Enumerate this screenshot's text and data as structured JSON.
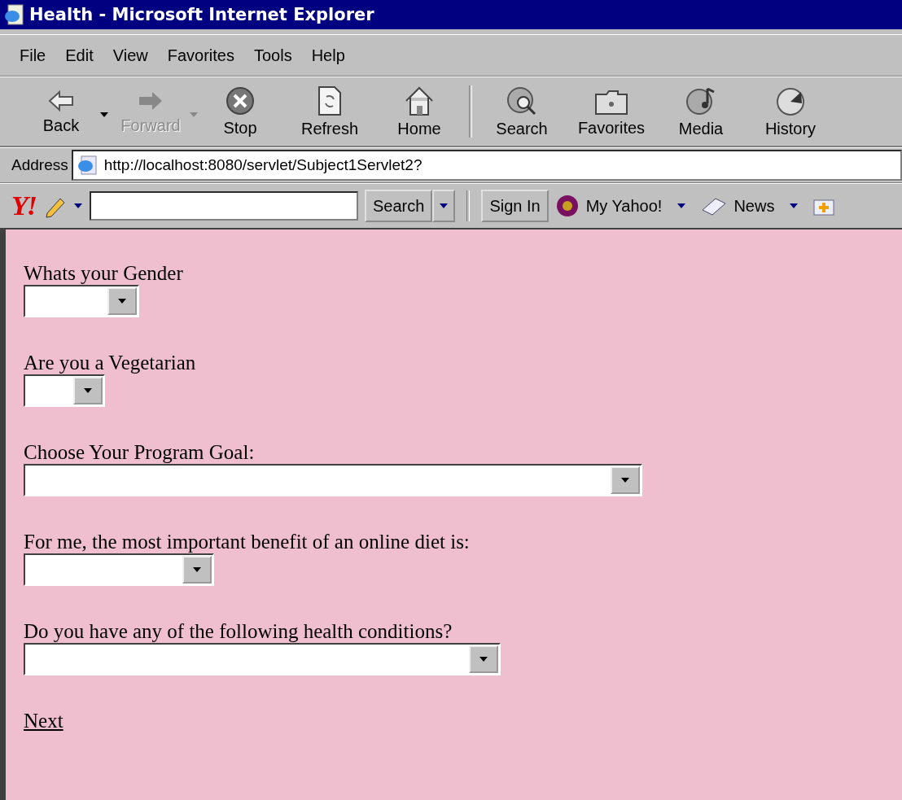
{
  "window": {
    "title": "Health - Microsoft Internet Explorer"
  },
  "menu": [
    "File",
    "Edit",
    "View",
    "Favorites",
    "Tools",
    "Help"
  ],
  "toolbar": [
    {
      "kind": "back",
      "label": "Back",
      "disabled": false
    },
    {
      "kind": "forward",
      "label": "Forward",
      "disabled": true
    },
    {
      "kind": "stop",
      "label": "Stop",
      "disabled": false
    },
    {
      "kind": "refresh",
      "label": "Refresh",
      "disabled": false
    },
    {
      "kind": "home",
      "label": "Home",
      "disabled": false
    },
    {
      "kind": "separator"
    },
    {
      "kind": "search",
      "label": "Search",
      "disabled": false
    },
    {
      "kind": "favorites",
      "label": "Favorites",
      "disabled": false
    },
    {
      "kind": "media",
      "label": "Media",
      "disabled": false
    },
    {
      "kind": "history",
      "label": "History",
      "disabled": false
    }
  ],
  "address": {
    "label": "Address",
    "url": "http://localhost:8080/servlet/Subject1Servlet2?"
  },
  "yahoo_bar": {
    "logo_text": "Y!",
    "search_button": "Search",
    "sign_in": "Sign In",
    "links": [
      "My Yahoo!",
      "News"
    ]
  },
  "page": {
    "questions": [
      {
        "label": "Whats your Gender"
      },
      {
        "label": "Are you a Vegetarian"
      },
      {
        "label": "Choose Your Program Goal:"
      },
      {
        "label": "For me, the most important benefit of an online diet is:"
      },
      {
        "label": "Do you have any of the following health conditions?"
      }
    ],
    "next_link": "Next"
  }
}
